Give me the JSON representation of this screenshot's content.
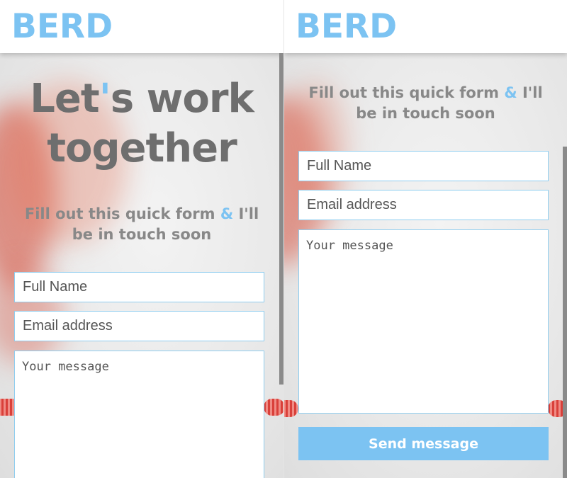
{
  "brand": {
    "logo": "BERD",
    "accent_color": "#7cc3f2"
  },
  "hero": {
    "title_part1": "Let",
    "title_apostrophe": "'",
    "title_part2": "s work",
    "title_line2": "together",
    "subtitle_part1": "Fill out this quick form ",
    "subtitle_amp": "&",
    "subtitle_part2": " I'll",
    "subtitle_line2": "be in touch soon"
  },
  "form": {
    "name_placeholder": "Full Name",
    "email_placeholder": "Email address",
    "message_placeholder": "Your message",
    "send_label": "Send message"
  }
}
